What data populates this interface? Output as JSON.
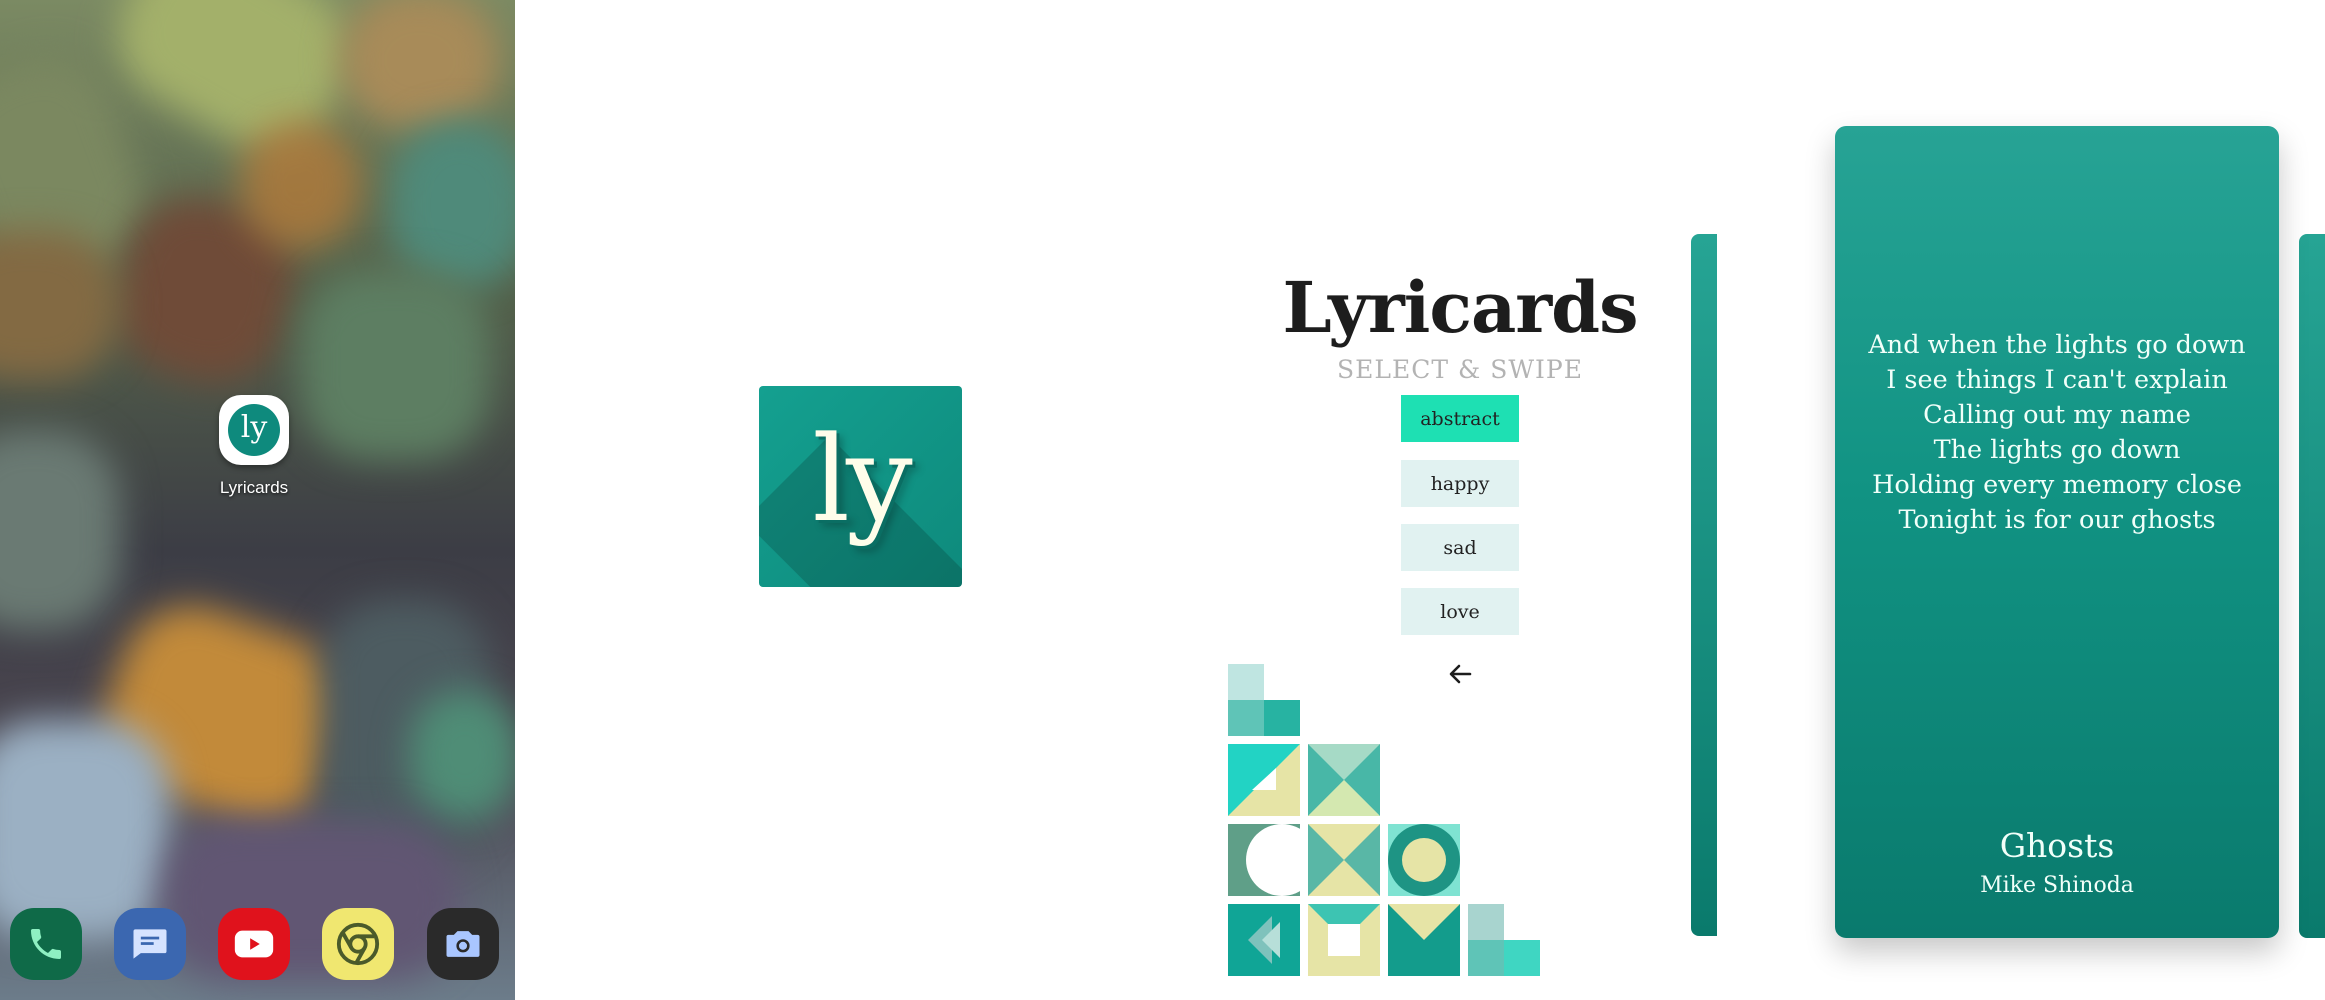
{
  "launcher": {
    "app_label": "Lyricards",
    "app_icon_text": "ly",
    "dock": [
      {
        "icon": "phone-icon",
        "color": "#0f6a48"
      },
      {
        "icon": "messages-icon",
        "color": "#3b67b0"
      },
      {
        "icon": "youtube-icon",
        "color": "#e0121c"
      },
      {
        "icon": "chrome-icon",
        "color": "#f0e770"
      },
      {
        "icon": "camera-icon",
        "color": "#2a2a2a"
      }
    ]
  },
  "logo": {
    "text": "ly"
  },
  "menu": {
    "title": "Lyricards",
    "subtitle": "SELECT & SWIPE",
    "categories": [
      "abstract",
      "happy",
      "sad",
      "love"
    ],
    "selected_category": "abstract"
  },
  "card": {
    "lyrics": [
      "And when the lights go down",
      "I see things I can't explain",
      "Calling out my name",
      "The lights go down",
      "Holding every memory close",
      "Tonight is for our ghosts"
    ],
    "song": "Ghosts",
    "artist": "Mike Shinoda"
  },
  "colors": {
    "teal": "#0e8a7d",
    "active_category": "#1ee0b3",
    "inactive_category": "#e1f2f1"
  }
}
